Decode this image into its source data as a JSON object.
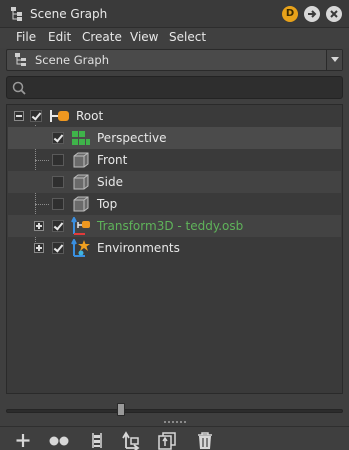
{
  "window": {
    "title": "Scene Graph",
    "controls": {
      "d_badge": "D"
    }
  },
  "menu": [
    "File",
    "Edit",
    "Create",
    "View",
    "Select"
  ],
  "view_selector": {
    "selected": "Scene Graph"
  },
  "search": {
    "placeholder": "",
    "value": ""
  },
  "tree": {
    "root": {
      "label": "Root",
      "checked": true,
      "expanded": true
    },
    "children": [
      {
        "label": "Perspective",
        "checked": true,
        "icon": "camera-group-icon",
        "color": "#e8e8e8"
      },
      {
        "label": "Front",
        "checked": false,
        "icon": "cube-icon",
        "color": "#e8e8e8"
      },
      {
        "label": "Side",
        "checked": false,
        "icon": "cube-icon",
        "color": "#e8e8e8"
      },
      {
        "label": "Top",
        "checked": false,
        "icon": "cube-icon",
        "color": "#e8e8e8"
      },
      {
        "label": "Transform3D - teddy.osb",
        "checked": true,
        "icon": "transform-icon",
        "color": "#5fb35a",
        "expandable": true
      },
      {
        "label": "Environments",
        "checked": true,
        "icon": "environment-icon",
        "color": "#e8e8e8",
        "expandable": true
      }
    ]
  },
  "slider": {
    "level": 0.34
  },
  "toolbar": [
    "add-icon",
    "link-nodes-icon",
    "group-icon",
    "reparent-icon",
    "duplicate-icon",
    "delete-icon"
  ],
  "colors": {
    "accent_orange": "#e8a21a",
    "node_green": "#5fb35a",
    "panel": "#3f3f3f"
  }
}
